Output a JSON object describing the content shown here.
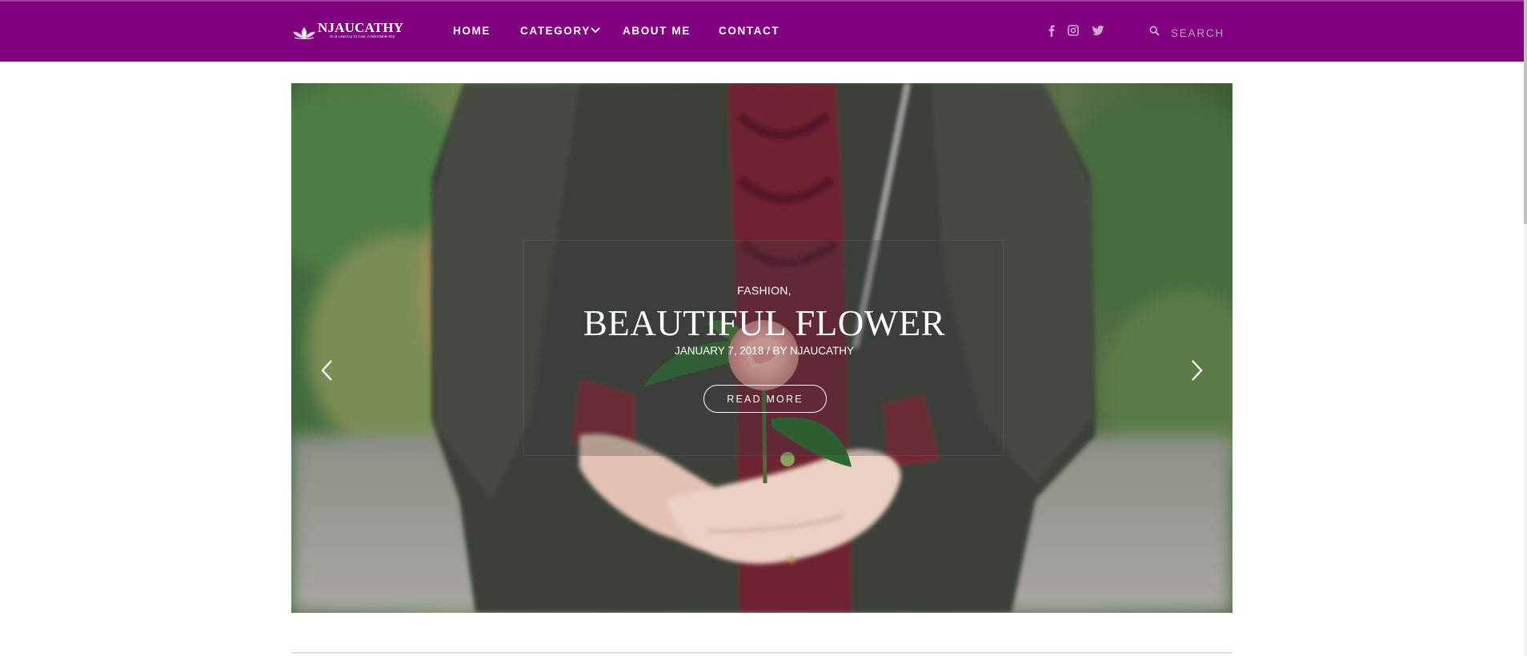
{
  "header": {
    "logo": {
      "name": "NJAUCATHY",
      "tagline": "Th at Lead Up To Lear, o Affordable Hip"
    },
    "nav": [
      {
        "label": "HOME"
      },
      {
        "label": "CATEGORY"
      },
      {
        "label": "ABOUT ME"
      },
      {
        "label": "CONTACT"
      }
    ],
    "social": [
      "facebook-icon",
      "instagram-icon",
      "twitter-icon"
    ],
    "search": {
      "placeholder": "SEARCH"
    },
    "colors": {
      "bar": "#800080"
    }
  },
  "slider": {
    "category": "FASHION,",
    "title": "BEAUTIFUL FLOWER",
    "meta": "JANUARY 7, 2018 / BY NJAUCATHY",
    "button": "READ MORE",
    "prev_icon": "chevron-left-icon",
    "next_icon": "chevron-right-icon"
  }
}
